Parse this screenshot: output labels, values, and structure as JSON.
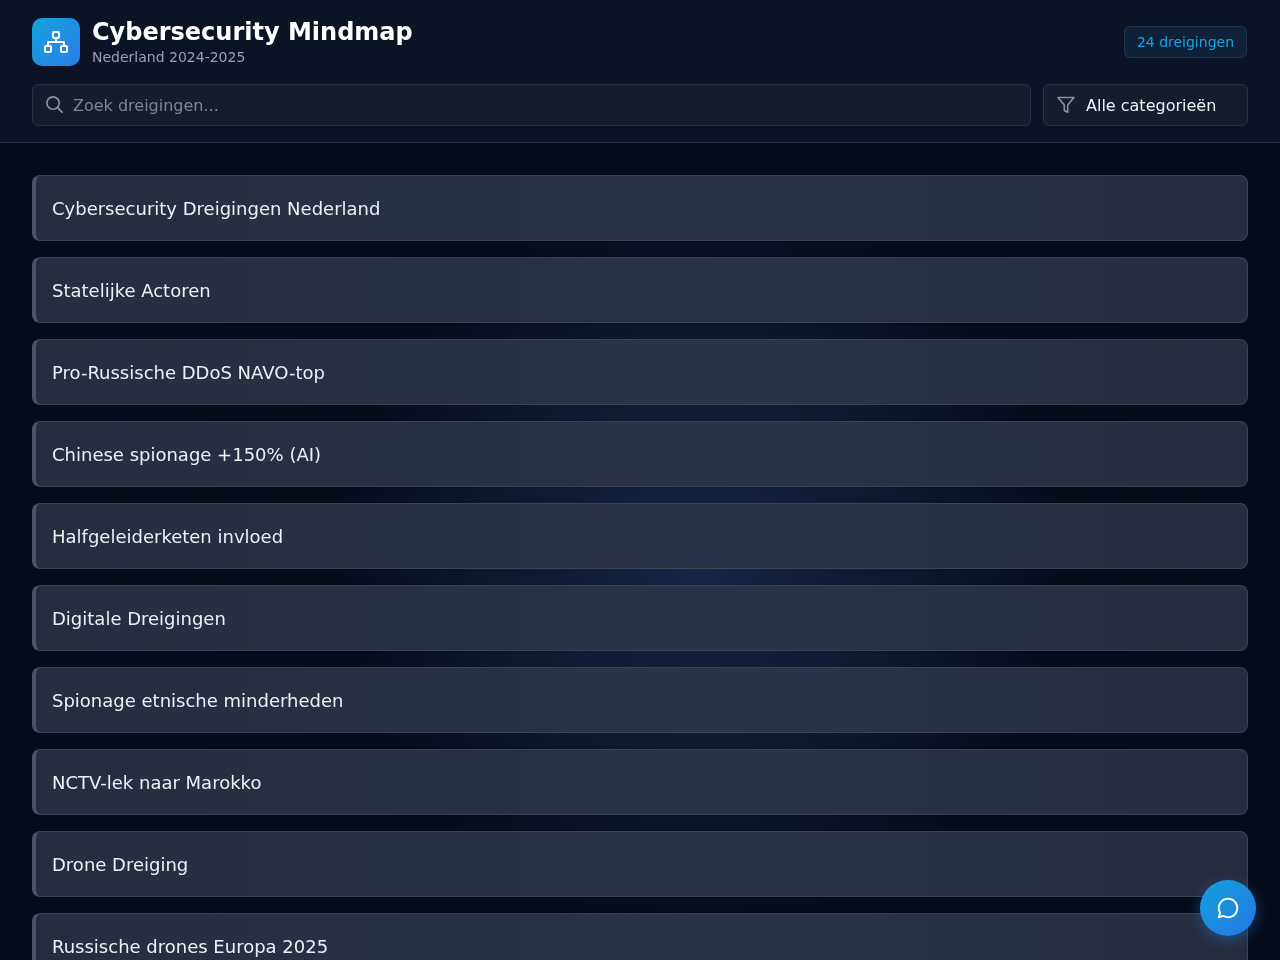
{
  "header": {
    "title": "Cybersecurity Mindmap",
    "subtitle": "Nederland 2024-2025",
    "count_badge": "24 dreigingen"
  },
  "search": {
    "placeholder": "Zoek dreigingen..."
  },
  "category_filter": {
    "value": "Alle categorieën"
  },
  "threats": [
    {
      "label": "Cybersecurity Dreigingen Nederland"
    },
    {
      "label": "Statelijke Actoren"
    },
    {
      "label": "Pro-Russische DDoS NAVO-top"
    },
    {
      "label": "Chinese spionage +150% (AI)"
    },
    {
      "label": "Halfgeleiderketen invloed"
    },
    {
      "label": "Digitale Dreigingen"
    },
    {
      "label": "Spionage etnische minderheden"
    },
    {
      "label": "NCTV-lek naar Marokko"
    },
    {
      "label": "Drone Dreiging"
    },
    {
      "label": "Russische drones Europa 2025"
    }
  ]
}
